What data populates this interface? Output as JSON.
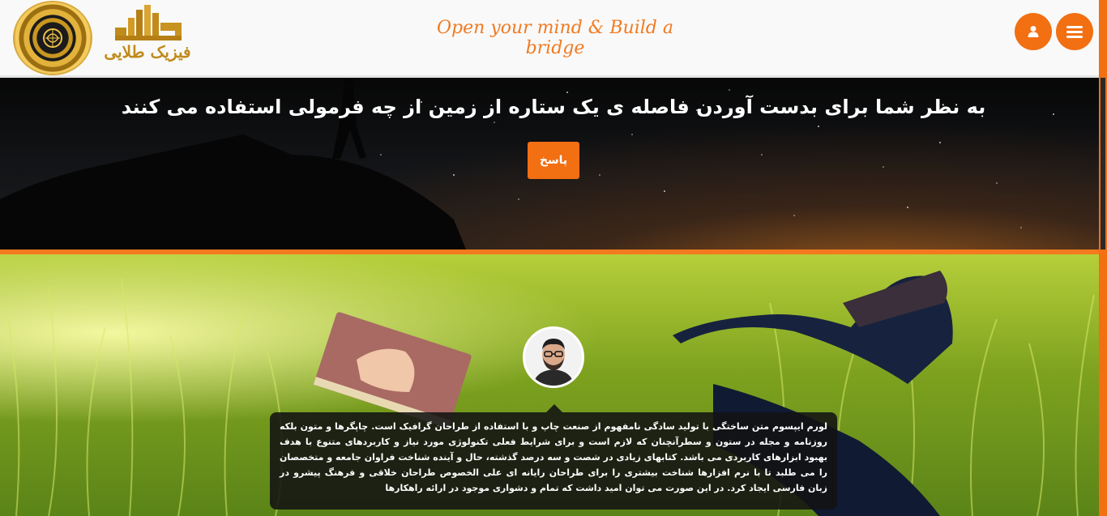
{
  "header": {
    "logo_text": "فیزیک طلایی",
    "tagline": "Open your mind & Build a bridge",
    "user_icon": "user-icon",
    "menu_icon": "hamburger-menu-icon"
  },
  "hero": {
    "question": "به نظر شما برای بدست آوردن فاصله ی یک ستاره از زمین از چه فرمولی استفاده می کنند",
    "answer_label": "پاسخ"
  },
  "testimonial": {
    "text": "لورم ایپسوم متن ساختگی با تولید سادگی نامفهوم از صنعت چاپ و با استفاده از طراحان گرافیک است. چاپگرها و متون بلکه روزنامه و مجله در ستون و سطرآنچنان که لازم است و برای شرایط فعلی تکنولوژی مورد نیاز و کاربردهای متنوع با هدف بهبود ابزارهای کاربردی می باشد. کتابهای زیادی در شصت و سه درصد گذشته، حال و آینده شناخت فراوان جامعه و متخصصان را می طلبد تا با نرم افزارها شناخت بیشتری را برای طراحان رایانه ای علی الخصوص طراحان خلاقی و فرهنگ پیشرو در زبان فارسی ایجاد کرد. در این صورت می توان امید داشت که تمام و دشواری موجود در ارائه راهکارها"
  },
  "colors": {
    "accent": "#f26f12",
    "divider": "#f47a1f",
    "logo_gold": "#c08b1b",
    "bubble_bg": "#121212"
  }
}
